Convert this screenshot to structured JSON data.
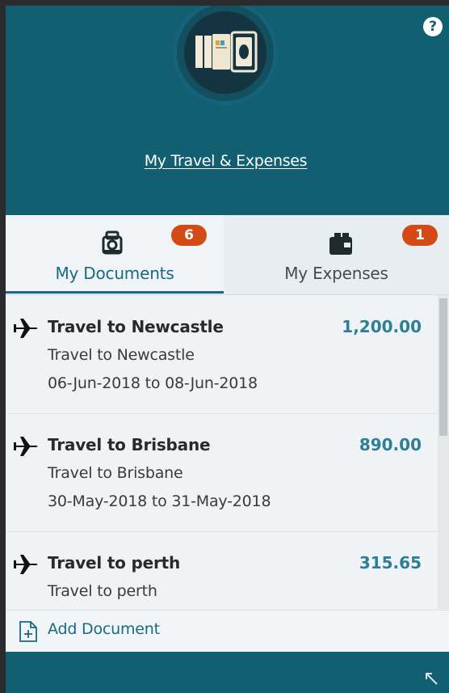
{
  "header": {
    "logo": "wallet-and-cards-logo",
    "help_icon": "?",
    "title": "My Travel & Expenses"
  },
  "tabs": [
    {
      "label": "My Documents",
      "badge": "6",
      "icon": "documents-icon",
      "active": true
    },
    {
      "label": "My Expenses",
      "badge": "1",
      "icon": "wallet-icon",
      "active": false
    }
  ],
  "documents": [
    {
      "title": "Travel to Newcastle",
      "subtitle": "Travel to Newcastle",
      "dates": "06-Jun-2018 to 08-Jun-2018",
      "amount": "1,200.00",
      "icon": "airplane-icon"
    },
    {
      "title": "Travel to Brisbane",
      "subtitle": "Travel to Brisbane",
      "dates": "30-May-2018 to 31-May-2018",
      "amount": "890.00",
      "icon": "airplane-icon"
    },
    {
      "title": "Travel to perth",
      "subtitle": "Travel to perth",
      "dates": "",
      "amount": "315.65",
      "icon": "airplane-icon"
    }
  ],
  "actions": {
    "add_document": "Add Document"
  },
  "colors": {
    "primary": "#135f72",
    "accent": "#176a80",
    "badge": "#d34a16",
    "amount": "#2c7f95"
  }
}
